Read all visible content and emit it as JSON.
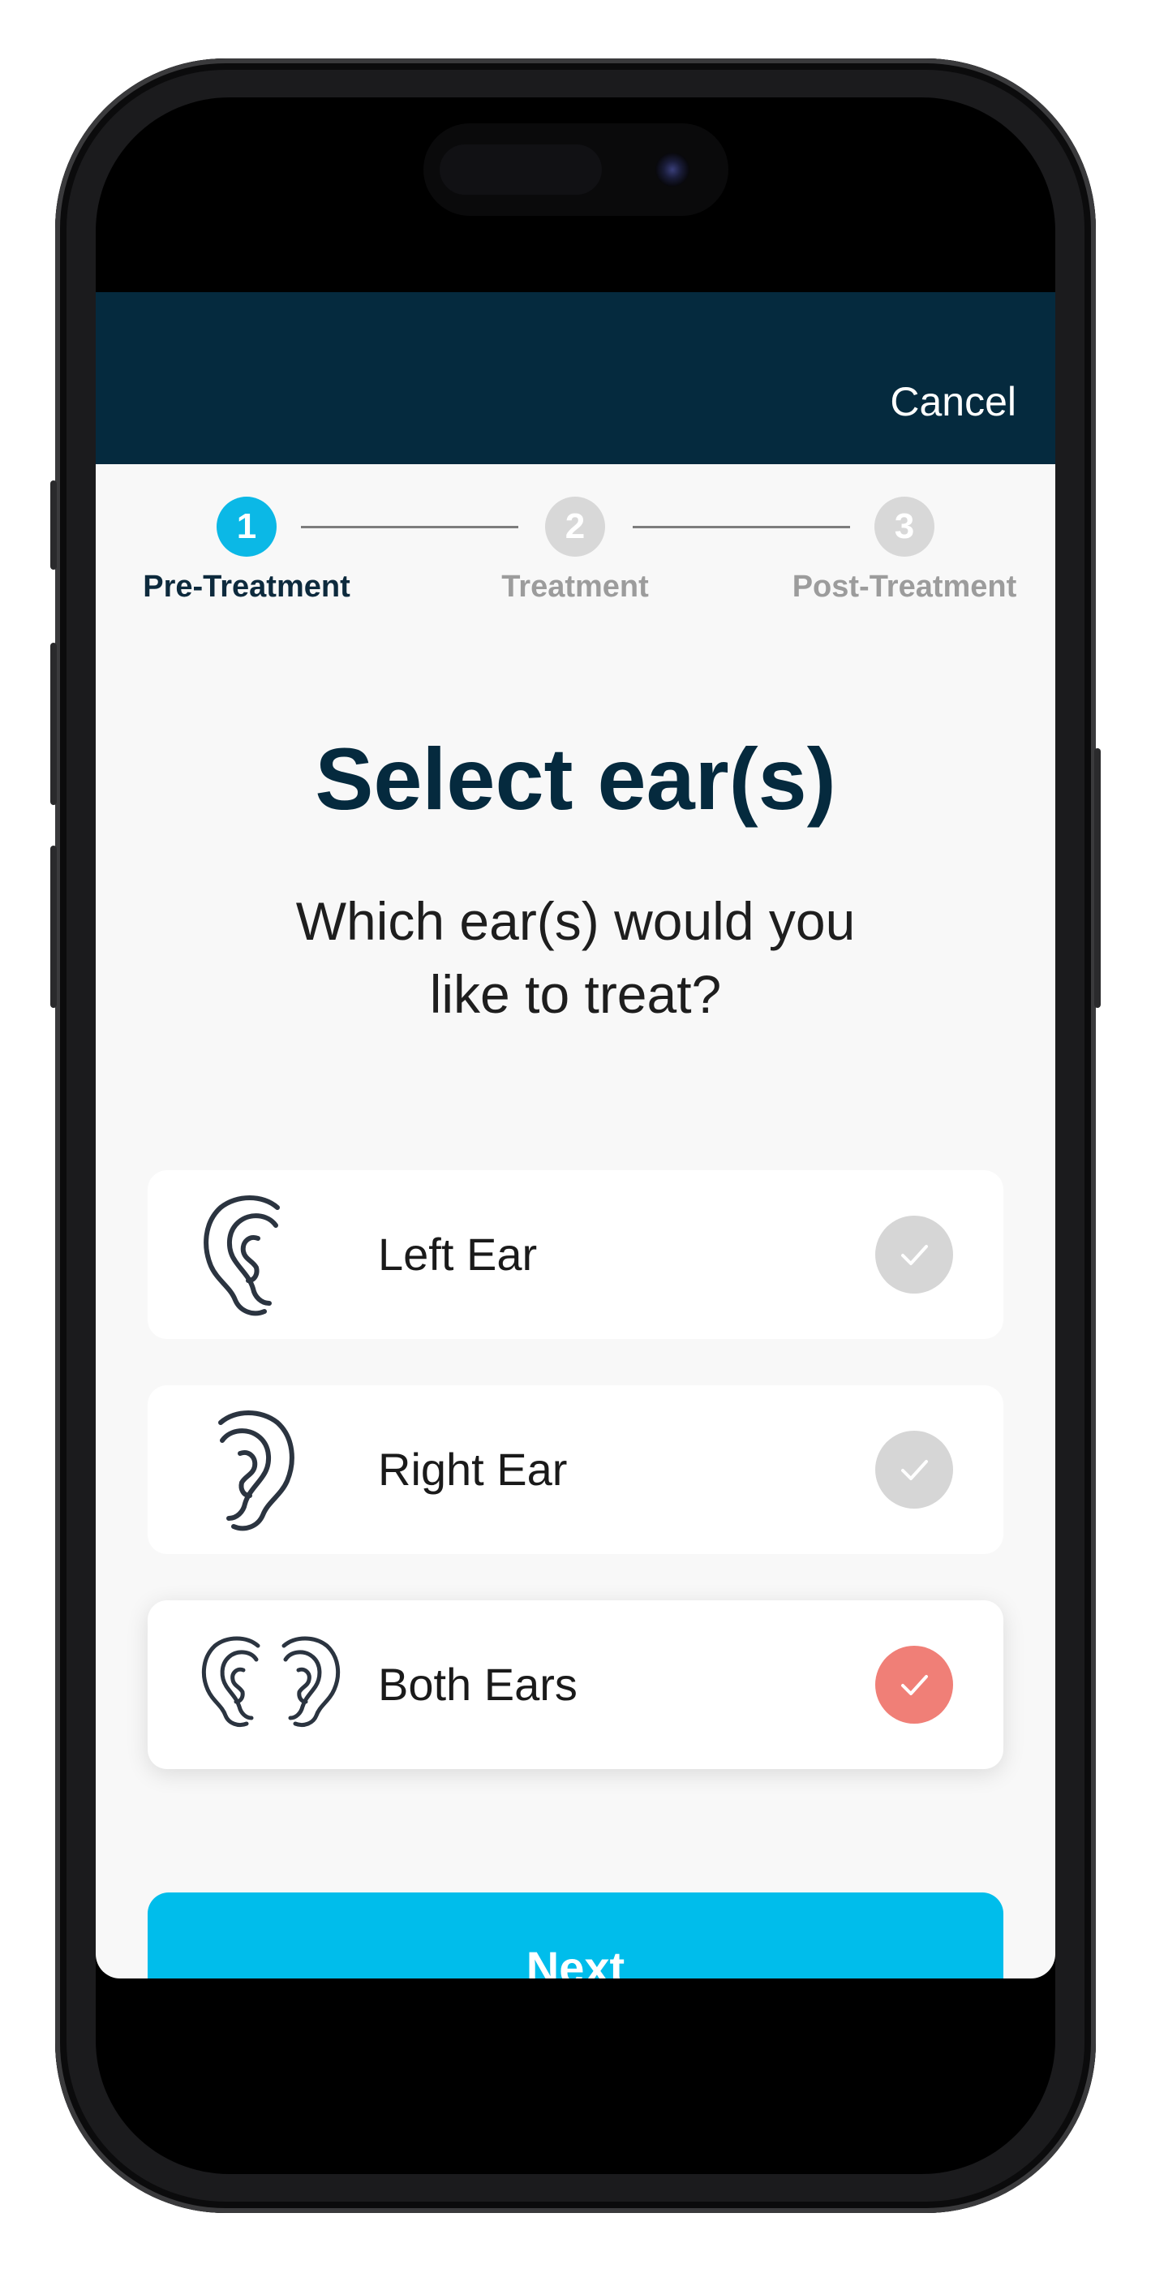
{
  "navbar": {
    "cancel_label": "Cancel"
  },
  "stepper": {
    "steps": [
      {
        "number": "1",
        "label": "Pre-Treatment",
        "state": "active"
      },
      {
        "number": "2",
        "label": "Treatment",
        "state": "inactive"
      },
      {
        "number": "3",
        "label": "Post-Treatment",
        "state": "inactive"
      }
    ]
  },
  "main": {
    "title": "Select ear(s)",
    "subtitle_line1": "Which ear(s) would you",
    "subtitle_line2": "like to treat?",
    "options": [
      {
        "label": "Left Ear",
        "icon": "left-ear-icon",
        "selected": false
      },
      {
        "label": "Right Ear",
        "icon": "right-ear-icon",
        "selected": false
      },
      {
        "label": "Both Ears",
        "icon": "both-ears-icon",
        "selected": true
      }
    ],
    "next_label": "Next"
  },
  "colors": {
    "navbar": "#052a3e",
    "accent": "#00bdeb",
    "step_active": "#0bb8e6",
    "selected_check": "#f07f77",
    "unselected_check": "#d6d6d6"
  }
}
